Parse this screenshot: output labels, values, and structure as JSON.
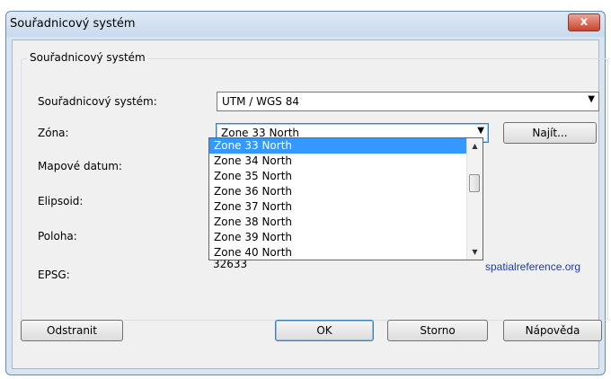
{
  "window": {
    "title": "Souřadnicový systém",
    "close_label": "x"
  },
  "group": {
    "title": "Souřadnicový systém"
  },
  "labels": {
    "system": "Souřadnicový systém:",
    "zone": "Zóna:",
    "datum": "Mapové datum:",
    "ellipsoid": "Elipsoid:",
    "position": "Poloha:",
    "epsg": "EPSG:"
  },
  "system_combo": {
    "value": "UTM / WGS 84"
  },
  "zone_combo": {
    "value": "Zone 33 North"
  },
  "find_button": "Najít...",
  "dropdown": {
    "items": [
      "Zone 33 North",
      "Zone 34 North",
      "Zone 35 North",
      "Zone 36 North",
      "Zone 37 North",
      "Zone 38 North",
      "Zone 39 North",
      "Zone 40 North"
    ],
    "selected_index": 0
  },
  "epsg_value": "32633",
  "epsg_link": "spatialreference.org",
  "buttons": {
    "remove": "Odstranit",
    "ok": "OK",
    "cancel": "Storno",
    "help": "Nápověda"
  },
  "icons": {
    "combo_arrow": "chevron-down-icon",
    "scroll_up": "chevron-up-icon",
    "scroll_down": "chevron-down-icon"
  }
}
